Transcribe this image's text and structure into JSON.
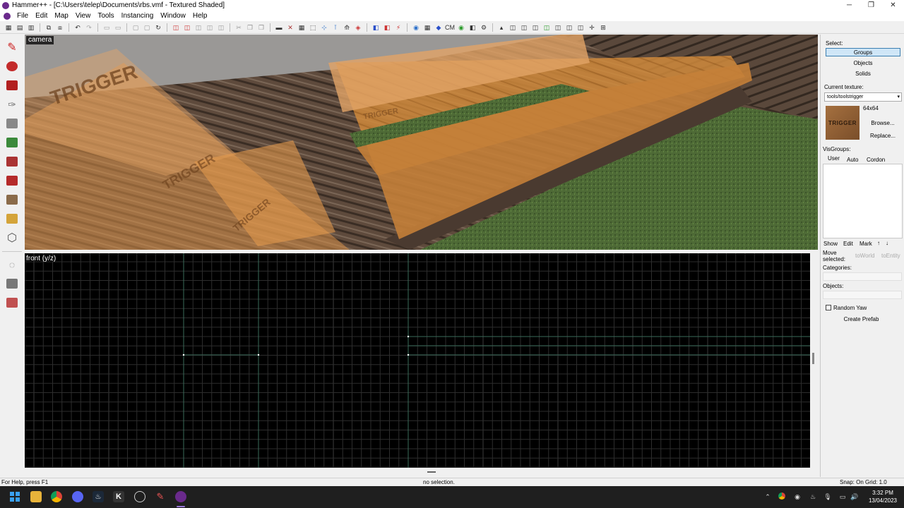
{
  "window": {
    "title": "Hammer++ - [C:\\Users\\telep\\Documents\\rbs.vmf - Textured Shaded]",
    "minimize_glyph": "─",
    "maximize_glyph": "❐",
    "close_glyph": "✕"
  },
  "menu": [
    "File",
    "Edit",
    "Map",
    "View",
    "Tools",
    "Instancing",
    "Window",
    "Help"
  ],
  "toolbar_icons": [
    "grid-icon",
    "grid-smaller-icon",
    "grid-larger-icon",
    "group-icon",
    "ungroup-icon",
    "undo-icon",
    "redo-icon",
    "cut-icon",
    "copy-icon",
    "paste-icon",
    "carve-icon",
    "hollow-icon",
    "texture-lock-icon",
    "ignore-groups-icon",
    "selection-icon",
    "hide-icon",
    "show-icon",
    "cordon-icon",
    "toggle-models-icon",
    "brush-outline-icon",
    "radius-culling-icon",
    "compile-icon"
  ],
  "viewports": {
    "camera_label": "camera",
    "camera_texture_text": "TRIGGER",
    "front_label": "front (y/z)"
  },
  "right_panel": {
    "select_label": "Select:",
    "select_buttons": [
      "Groups",
      "Objects",
      "Solids"
    ],
    "current_texture_label": "Current texture:",
    "current_texture_value": "tools/toolstrigger",
    "dropdown_arrow": "▾",
    "texture_size": "64x64",
    "texture_thumb_text": "TRIGGER",
    "browse_button": "Browse...",
    "replace_button": "Replace...",
    "visgroups_label": "VisGroups:",
    "visgroup_tabs": [
      "User",
      "Auto",
      "Cordon"
    ],
    "visgroup_actions": [
      "Show",
      "Edit",
      "Mark"
    ],
    "arrow_up": "↑",
    "arrow_down": "↓",
    "move_selected_label": "Move selected:",
    "to_world": "toWorld",
    "to_entity": "toEntity",
    "categories_label": "Categories:",
    "objects_label": "Objects:",
    "random_yaw_label": "Random Yaw",
    "create_prefab_button": "Create Prefab"
  },
  "status": {
    "help": "For Help, press F1",
    "selection": "no selection.",
    "snap": "Snap: On Grid: 1.0"
  },
  "taskbar": {
    "time": "3:32 PM",
    "date": "13/04/2023"
  },
  "colors": {
    "accent": "#3c7fb1",
    "grid_line": "#2d2d2d",
    "grid_major": "#3a6b5a",
    "trigger_orange": "#d08a3c"
  }
}
